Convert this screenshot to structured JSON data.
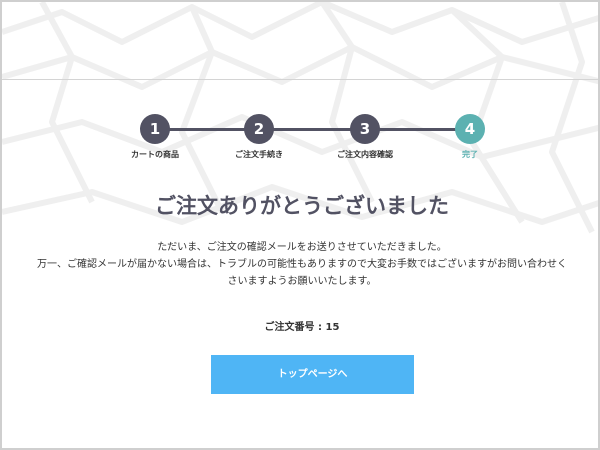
{
  "steps": [
    {
      "number": "1",
      "label": "カートの商品"
    },
    {
      "number": "2",
      "label": "ご注文手続き"
    },
    {
      "number": "3",
      "label": "ご注文内容確認"
    },
    {
      "number": "4",
      "label": "完了"
    }
  ],
  "title": "ご注文ありがとうございました",
  "message": {
    "line1": "ただいま、ご注文の確認メールをお送りさせていただきました。",
    "line2": "万一、ご確認メールが届かない場合は、トラブルの可能性もありますので大変お手数ではございますがお問い合わせく",
    "line3": "さいますようお願いいたします。"
  },
  "order": {
    "label": "ご注文番号 : 15"
  },
  "button": {
    "label": "トップページへ"
  },
  "colors": {
    "step_default": "#525263",
    "step_active": "#5cb1b1",
    "button": "#4fb5f5",
    "title": "#525263"
  }
}
